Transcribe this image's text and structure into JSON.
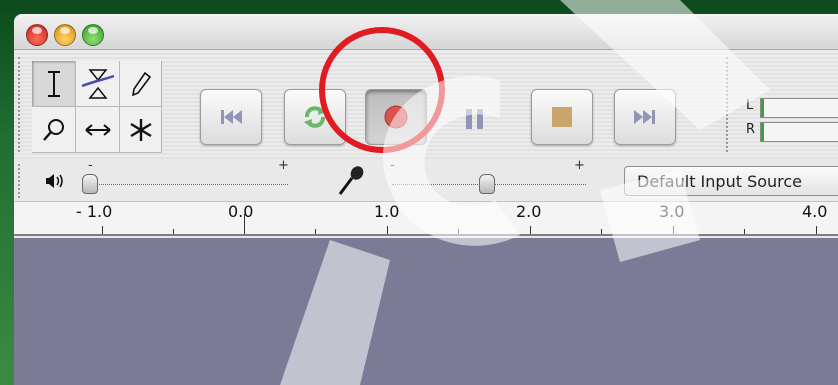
{
  "window": {
    "traffic_lights": [
      "close",
      "minimize",
      "zoom"
    ]
  },
  "tools": [
    {
      "name": "selection-tool",
      "icon": "i-beam-icon",
      "selected": true
    },
    {
      "name": "envelope-tool",
      "icon": "envelope-icon",
      "selected": false
    },
    {
      "name": "draw-tool",
      "icon": "pencil-icon",
      "selected": false
    },
    {
      "name": "zoom-tool",
      "icon": "magnifier-icon",
      "selected": false
    },
    {
      "name": "timeshift-tool",
      "icon": "double-arrow-icon",
      "selected": false
    },
    {
      "name": "multi-tool",
      "icon": "asterisk-icon",
      "selected": false
    }
  ],
  "transport": {
    "buttons": [
      "skip-to-start",
      "play",
      "record",
      "pause",
      "stop",
      "skip-to-end"
    ],
    "pressed": "record",
    "colors": {
      "record": "#d9534f",
      "icons": "#8f95b8",
      "play": "#67b86a",
      "stop": "#c9a56b"
    },
    "highlight_color": "#e01b22"
  },
  "meter": {
    "left_label": "L",
    "right_label": "R"
  },
  "mixer": {
    "output_minus": "-",
    "output_plus": "+",
    "input_minus": "-",
    "input_plus": "+",
    "input_source": "Default Input Source"
  },
  "ruler": {
    "labels": [
      "- 1.0",
      "0.0",
      "1.0",
      "2.0",
      "3.0",
      "4.0"
    ]
  },
  "colors": {
    "desktop": "#1f6e32",
    "track_area": "#7b7b97"
  }
}
